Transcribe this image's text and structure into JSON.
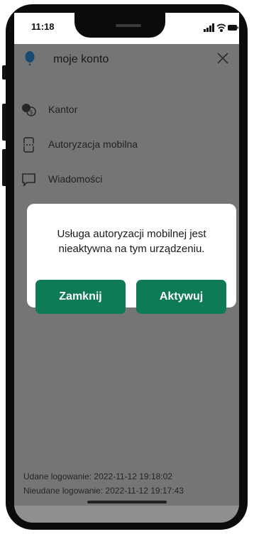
{
  "status_bar": {
    "time": "11:18"
  },
  "menu": {
    "title": "moje konto",
    "items": [
      {
        "label": "Kantor",
        "icon": "currency-exchange-icon"
      },
      {
        "label": "Autoryzacja mobilna",
        "icon": "mobile-authorization-icon"
      },
      {
        "label": "Wiadomości",
        "icon": "message-icon"
      }
    ]
  },
  "footer": {
    "successful_login": "Udane logowanie: 2022-11-12 19:18:02",
    "failed_login": "Nieudane logowanie: 2022-11-12 19:17:43"
  },
  "dialog": {
    "message": "Usługa autoryzacji mobilnej jest nieaktywna na tym urządzeniu.",
    "close_label": "Zamknij",
    "activate_label": "Aktywuj"
  },
  "colors": {
    "accent": "#0e7a56",
    "overlay": "#8f8f8f"
  }
}
